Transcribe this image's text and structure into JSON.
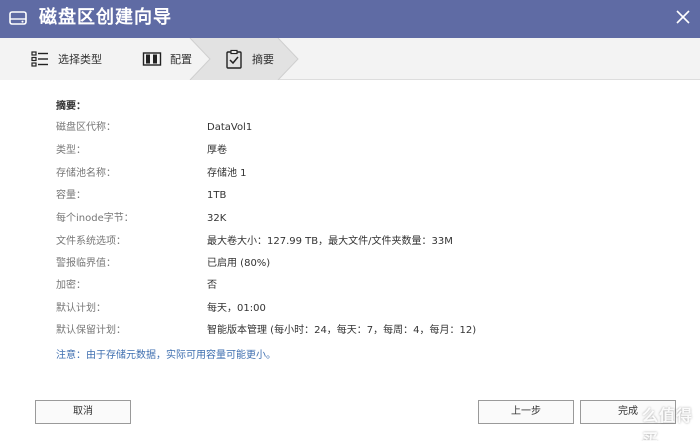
{
  "window": {
    "title": "磁盘区创建向导"
  },
  "steps": [
    {
      "label": "选择类型",
      "icon": "list-icon",
      "active": false
    },
    {
      "label": "配置",
      "icon": "columns-icon",
      "active": false
    },
    {
      "label": "摘要",
      "icon": "clipboard-icon",
      "active": true
    }
  ],
  "summary": {
    "heading": "摘要：",
    "rows": [
      {
        "label": "磁盘区代称：",
        "value": "DataVol1"
      },
      {
        "label": "类型：",
        "value": "厚卷"
      },
      {
        "label": "存储池名称：",
        "value": "存储池 1"
      },
      {
        "label": "容量：",
        "value": "1TB"
      },
      {
        "label": "每个inode字节：",
        "value": "32K"
      },
      {
        "label": "文件系统选项：",
        "value": "最大卷大小：127.99 TB，最大文件/文件夹数量：33M"
      },
      {
        "label": "警报临界值：",
        "value": "已启用 (80%)"
      },
      {
        "label": "加密：",
        "value": "否"
      },
      {
        "label": "默认计划：",
        "value": "每天，01:00"
      },
      {
        "label": "默认保留计划：",
        "value": "智能版本管理 (每小时：24，每天：7，每周：4，每月：12)"
      }
    ],
    "note": "注意：由于存储元数据，实际可用容量可能更小。"
  },
  "buttons": {
    "cancel": "取消",
    "prev": "上一步",
    "done": "完成"
  },
  "watermark": {
    "text": "值 么值得买",
    "main": "么值得买"
  },
  "colors": {
    "titlebar": "#5f6ba4",
    "note": "#3f6fb0",
    "step_active": "#e2e2e2"
  }
}
